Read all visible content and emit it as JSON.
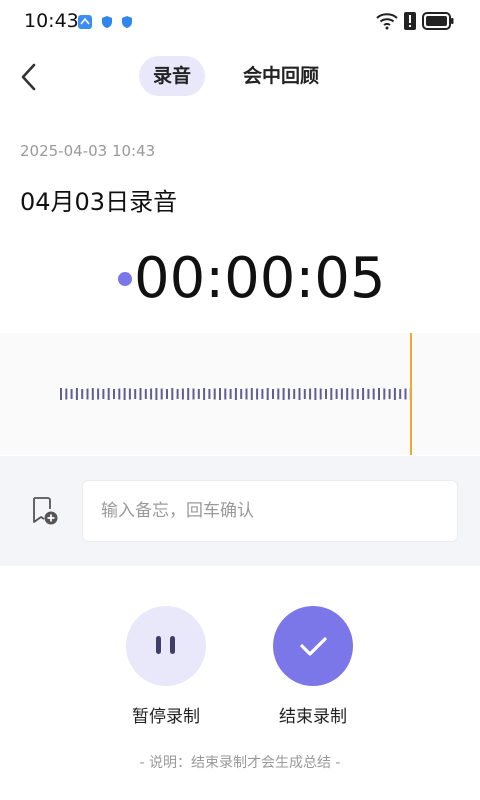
{
  "status_bar": {
    "time": "10:43",
    "icons": [
      "notification-app-icon",
      "shield-icon",
      "shield-icon",
      "wifi-icon",
      "alert-icon",
      "battery-icon"
    ]
  },
  "header": {
    "tabs": [
      {
        "label": "录音",
        "active": true
      },
      {
        "label": "会中回顾",
        "active": false
      }
    ]
  },
  "recording": {
    "datetime": "2025-04-03 10:43",
    "title": "04月03日录音",
    "elapsed": "00:00:05"
  },
  "memo": {
    "placeholder": "输入备忘，回车确认"
  },
  "controls": {
    "pause_label": "暂停录制",
    "end_label": "结束录制"
  },
  "note": "- 说明：结束录制才会生成总结 -",
  "colors": {
    "accent": "#7b77e8",
    "accent_light": "#e9e8fb",
    "playhead": "#f0a830",
    "wave": "#5f5d92"
  }
}
